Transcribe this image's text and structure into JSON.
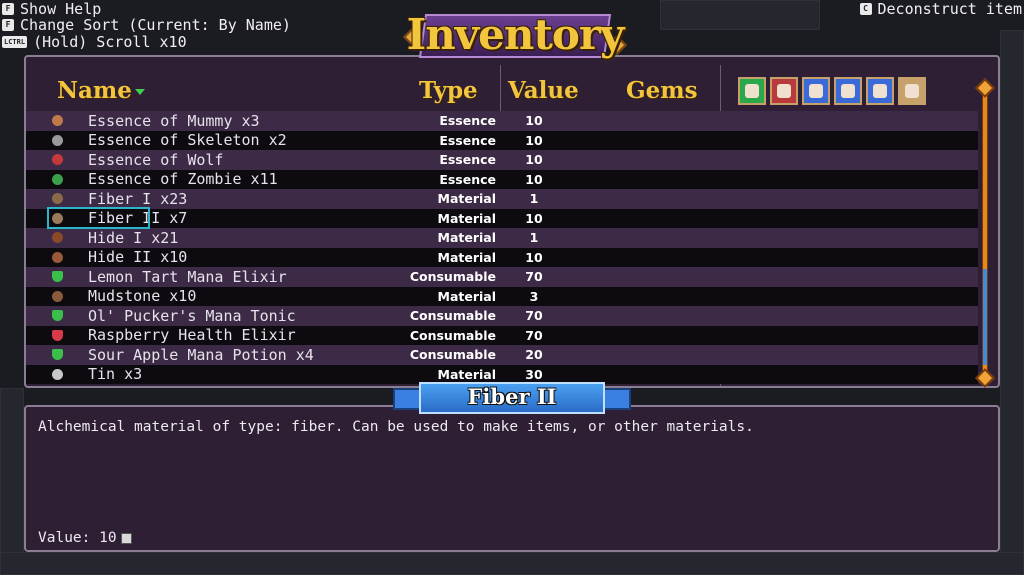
{
  "hints": {
    "help": {
      "key": "F",
      "label": "Show Help"
    },
    "sort": {
      "key": "F",
      "label": "Change Sort (Current: By Name)"
    },
    "scroll": {
      "key": "LCTRL",
      "label": "(Hold) Scroll x10"
    },
    "deconstruct": {
      "key": "C",
      "label": "Deconstruct item"
    }
  },
  "title": "Inventory",
  "headers": {
    "name": "Name",
    "type": "Type",
    "value": "Value",
    "gems": "Gems"
  },
  "filters": [
    {
      "icon": "heart-icon",
      "color": "#2aa84a"
    },
    {
      "icon": "crossed-swords-icon",
      "color": "#b83a3a"
    },
    {
      "icon": "target-icon",
      "color": "#3a6ad8"
    },
    {
      "icon": "armor-icon",
      "color": "#3a6ad8"
    },
    {
      "icon": "boot-icon",
      "color": "#3a6ad8"
    },
    {
      "icon": "shield-icon",
      "color": "#c7a16b"
    }
  ],
  "items": [
    {
      "name": "Essence of Mummy x3",
      "type": "Essence",
      "value": "10",
      "icon": "mummy-essence-icon",
      "color": "#c07a4a"
    },
    {
      "name": "Essence of Skeleton x2",
      "type": "Essence",
      "value": "10",
      "icon": "skeleton-essence-icon",
      "color": "#9a9a9a"
    },
    {
      "name": "Essence of Wolf",
      "type": "Essence",
      "value": "10",
      "icon": "wolf-essence-icon",
      "color": "#c43a3a"
    },
    {
      "name": "Essence of Zombie x11",
      "type": "Essence",
      "value": "10",
      "icon": "zombie-essence-icon",
      "color": "#3aa04a"
    },
    {
      "name": "Fiber I x23",
      "type": "Material",
      "value": "1",
      "icon": "fiber-icon",
      "color": "#8a6a4a"
    },
    {
      "name": "Fiber II x7",
      "type": "Material",
      "value": "10",
      "icon": "fiber-icon",
      "color": "#9a7a5a"
    },
    {
      "name": "Hide I x21",
      "type": "Material",
      "value": "1",
      "icon": "hide-icon",
      "color": "#8a4a2a"
    },
    {
      "name": "Hide II x10",
      "type": "Material",
      "value": "10",
      "icon": "hide-icon",
      "color": "#9a5a3a"
    },
    {
      "name": "Lemon Tart Mana Elixir",
      "type": "Consumable",
      "value": "70",
      "icon": "potion-icon",
      "color": "#3ac04a"
    },
    {
      "name": "Mudstone x10",
      "type": "Material",
      "value": "3",
      "icon": "stone-icon",
      "color": "#8a5a3a"
    },
    {
      "name": "Ol' Pucker's Mana Tonic",
      "type": "Consumable",
      "value": "70",
      "icon": "potion-icon",
      "color": "#3ac04a"
    },
    {
      "name": "Raspberry Health Elixir",
      "type": "Consumable",
      "value": "70",
      "icon": "potion-icon",
      "color": "#d83a4a"
    },
    {
      "name": "Sour Apple Mana Potion x4",
      "type": "Consumable",
      "value": "20",
      "icon": "potion-icon",
      "color": "#3ac04a"
    },
    {
      "name": "Tin x3",
      "type": "Material",
      "value": "30",
      "icon": "ingot-icon",
      "color": "#c8c8cc"
    }
  ],
  "selected": {
    "name": "Fiber II",
    "description": "Alchemical material of type: fiber. Can be used to make items, or other materials.",
    "value_label": "Value: 10"
  }
}
